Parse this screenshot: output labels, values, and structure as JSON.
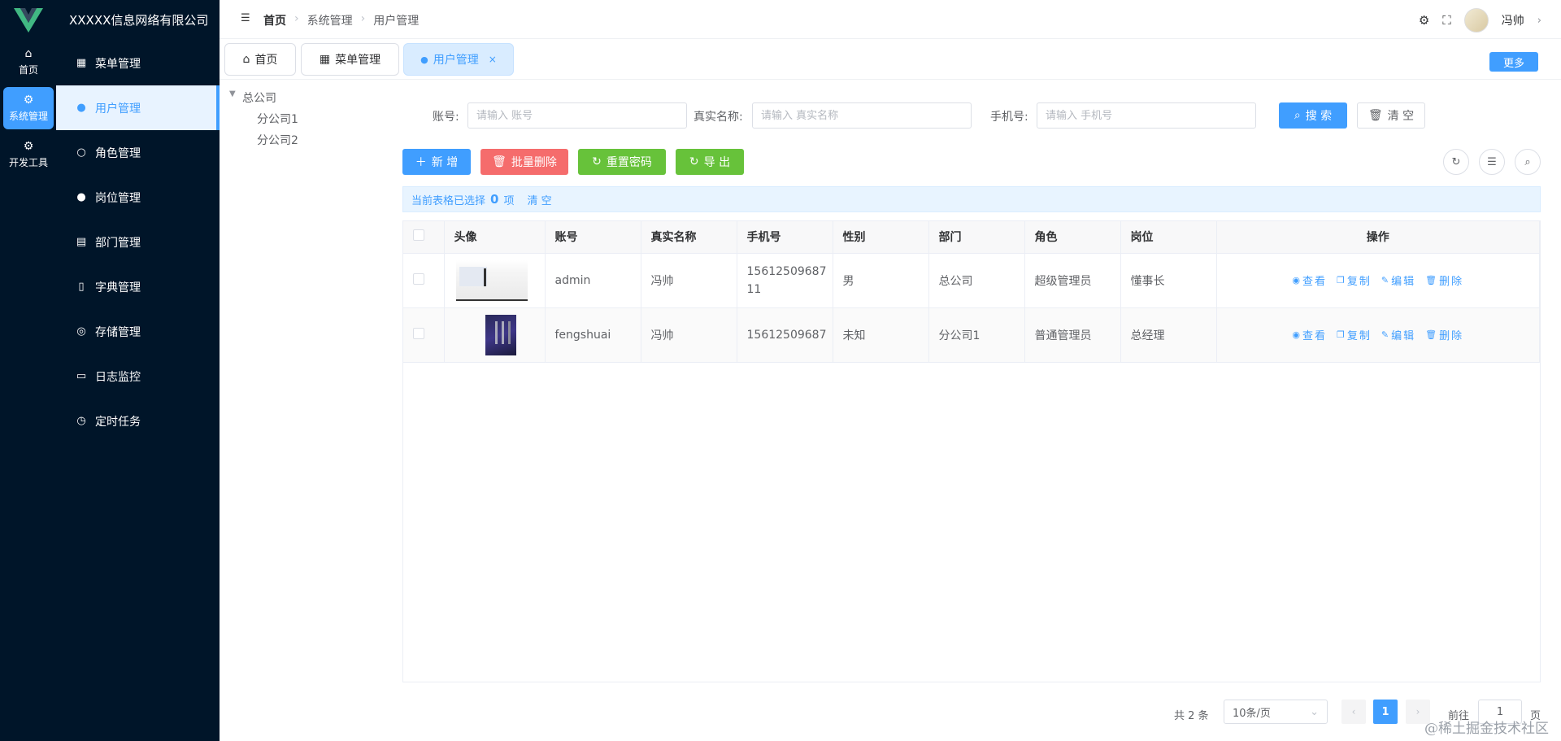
{
  "company": "XXXXX信息网络有限公司",
  "rail": [
    {
      "icon": "home-icon",
      "glyph": "⌂",
      "label": "首页"
    },
    {
      "icon": "gear-icon",
      "glyph": "⚙",
      "label": "系统管理"
    },
    {
      "icon": "tools-icon",
      "glyph": "⚙",
      "label": "开发工具"
    }
  ],
  "submenu": [
    {
      "icon": "grid-icon",
      "glyph": "▦",
      "label": "菜单管理"
    },
    {
      "icon": "user-icon",
      "glyph": "●",
      "label": "用户管理"
    },
    {
      "icon": "role-icon",
      "glyph": "○",
      "label": "角色管理"
    },
    {
      "icon": "post-icon",
      "glyph": "●",
      "label": "岗位管理"
    },
    {
      "icon": "building-icon",
      "glyph": "▤",
      "label": "部门管理"
    },
    {
      "icon": "book-icon",
      "glyph": "▯",
      "label": "字典管理"
    },
    {
      "icon": "database-icon",
      "glyph": "◎",
      "label": "存储管理"
    },
    {
      "icon": "message-icon",
      "glyph": "▭",
      "label": "日志监控"
    },
    {
      "icon": "timer-icon",
      "glyph": "◷",
      "label": "定时任务"
    }
  ],
  "header": {
    "breadcrumb": [
      "首页",
      "系统管理",
      "用户管理"
    ],
    "user": "冯帅"
  },
  "tabs": [
    {
      "label": "首页",
      "glyph": "⌂"
    },
    {
      "label": "菜单管理",
      "glyph": "▦"
    },
    {
      "label": "用户管理",
      "glyph": "●"
    }
  ],
  "more_label": "更多",
  "tree": {
    "root": "总公司",
    "children": [
      "分公司1",
      "分公司2"
    ]
  },
  "search": {
    "account_label": "账号:",
    "account_placeholder": "请输入 账号",
    "realname_label": "真实名称:",
    "realname_placeholder": "请输入 真实名称",
    "phone_label": "手机号:",
    "phone_placeholder": "请输入 手机号",
    "search_btn": "搜 索",
    "clear_btn": "清 空"
  },
  "toolbar": {
    "add": "新 增",
    "batch_delete": "批量删除",
    "reset_password": "重置密码",
    "export": "导 出"
  },
  "selection": {
    "prefix": "当前表格已选择",
    "count": "0",
    "suffix": "项",
    "clear": "清 空"
  },
  "table": {
    "headers": [
      "头像",
      "账号",
      "真实名称",
      "手机号",
      "性别",
      "部门",
      "角色",
      "岗位",
      "操作"
    ],
    "rows": [
      {
        "account": "admin",
        "name": "冯帅",
        "phone": "1561250968711",
        "gender": "男",
        "dept": "总公司",
        "role": "超级管理员",
        "post": "懂事长"
      },
      {
        "account": "fengshuai",
        "name": "冯帅",
        "phone": "15612509687",
        "gender": "未知",
        "dept": "分公司1",
        "role": "普通管理员",
        "post": "总经理"
      }
    ],
    "actions": {
      "view": "查看",
      "copy": "复制",
      "edit": "编辑",
      "delete": "删除"
    }
  },
  "pagination": {
    "total": "共 2 条",
    "size": "10条/页",
    "current": "1",
    "goto": "前往",
    "goto_value": "1",
    "unit": "页"
  },
  "watermark": "@稀土掘金技术社区",
  "colors": {
    "primary": "#409eff",
    "danger": "#f56c6c",
    "success": "#67c23a",
    "sidebar": "#001529"
  }
}
